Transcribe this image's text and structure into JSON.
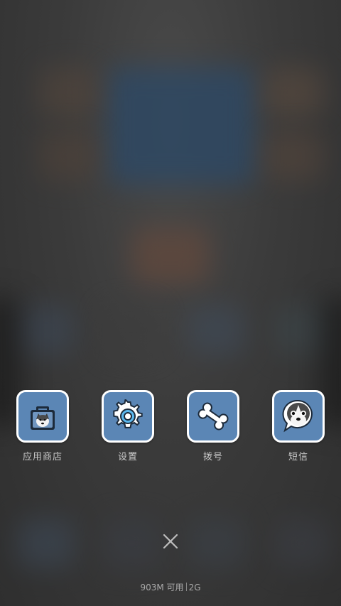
{
  "dock": {
    "apps": [
      {
        "label": "应用商店",
        "icon": "app-store-bag-icon"
      },
      {
        "label": "设置",
        "icon": "gear-icon"
      },
      {
        "label": "拨号",
        "icon": "bone-icon"
      },
      {
        "label": "短信",
        "icon": "husky-speech-bubble-icon"
      }
    ]
  },
  "close_button": {
    "icon": "close-icon"
  },
  "status": {
    "memory": "903M 可用",
    "network": "2G"
  },
  "colors": {
    "tile_bg": "#5b86b5",
    "tile_border": "#ffffff",
    "label": "#c9c9c9"
  }
}
